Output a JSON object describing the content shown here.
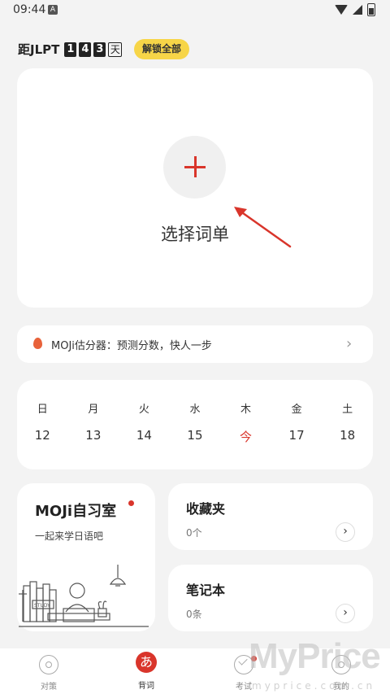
{
  "status_bar": {
    "time": "09:44",
    "notif_glyph": "A"
  },
  "countdown": {
    "prefix": "距JLPT",
    "digits": [
      "1",
      "4",
      "3"
    ],
    "unit": "天"
  },
  "unlock_button": "解锁全部",
  "main_card": {
    "plus_glyph": "+",
    "label": "选择词单"
  },
  "banner": {
    "text": "MOJi估分器：预测分数，快人一步",
    "chevron": "›"
  },
  "calendar": {
    "weekdays": [
      "日",
      "月",
      "火",
      "水",
      "木",
      "金",
      "土"
    ],
    "dates": [
      "12",
      "13",
      "14",
      "15",
      "今",
      "17",
      "18"
    ],
    "today_index": 4
  },
  "study_room": {
    "title": "MOJi自习室",
    "subtitle": "一起来学日语吧",
    "sign_text": "STUDY"
  },
  "favorites": {
    "title": "收藏夹",
    "count": "0个",
    "chevron": "›"
  },
  "notebook": {
    "title": "笔记本",
    "count": "0条",
    "chevron": "›"
  },
  "bottom_nav": {
    "items": [
      {
        "label": "对策",
        "icon": "target-icon"
      },
      {
        "label": "背词",
        "icon": "kana-a-icon",
        "glyph": "あ",
        "active": true
      },
      {
        "label": "考试",
        "icon": "check-icon"
      },
      {
        "label": "我的",
        "icon": "profile-icon"
      }
    ]
  },
  "watermark": {
    "text": "MyPrice",
    "sub": "myprice.com.cn"
  },
  "colors": {
    "accent": "#d9352b",
    "unlock": "#f7d548",
    "background": "#f3f3f3"
  }
}
